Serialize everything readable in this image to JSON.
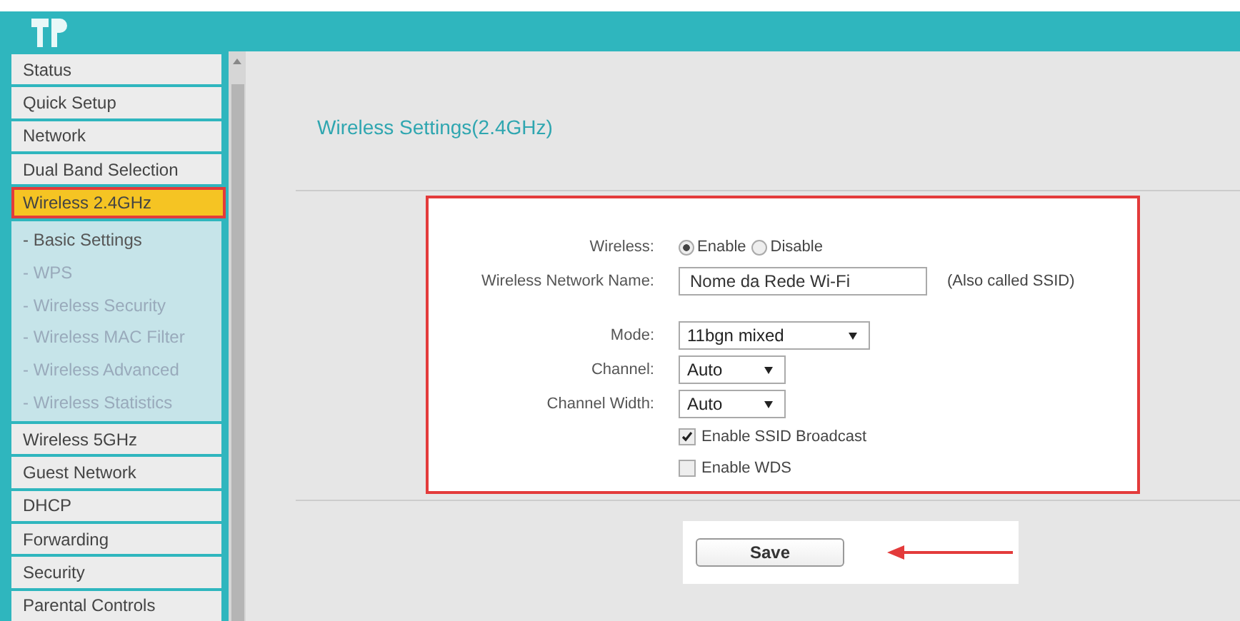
{
  "sidebar": {
    "items": [
      {
        "label": "Status",
        "selected": false
      },
      {
        "label": "Quick Setup",
        "selected": false
      },
      {
        "label": "Network",
        "selected": false
      },
      {
        "label": "Dual Band Selection",
        "selected": false
      },
      {
        "label": "Wireless 2.4GHz",
        "selected": true,
        "expanded": true,
        "children": [
          {
            "label": "- Basic Settings",
            "selected": true
          },
          {
            "label": "- WPS",
            "selected": false
          },
          {
            "label": "- Wireless Security",
            "selected": false
          },
          {
            "label": "- Wireless MAC Filter",
            "selected": false
          },
          {
            "label": "- Wireless Advanced",
            "selected": false
          },
          {
            "label": "- Wireless Statistics",
            "selected": false
          }
        ]
      },
      {
        "label": "Wireless 5GHz",
        "selected": false
      },
      {
        "label": "Guest Network",
        "selected": false
      },
      {
        "label": "DHCP",
        "selected": false
      },
      {
        "label": "Forwarding",
        "selected": false
      },
      {
        "label": "Security",
        "selected": false
      },
      {
        "label": "Parental Controls",
        "selected": false
      }
    ]
  },
  "page_title": "Wireless Settings(2.4GHz)",
  "form": {
    "wireless": {
      "label": "Wireless:",
      "options": [
        {
          "label": "Enable",
          "selected": true
        },
        {
          "label": "Disable",
          "selected": false
        }
      ]
    },
    "network_name": {
      "label": "Wireless Network Name:",
      "value": "Nome da Rede Wi-Fi",
      "hint": "(Also called SSID)"
    },
    "selects": [
      {
        "label": "Mode:",
        "value": "11bgn mixed"
      },
      {
        "label": "Channel:",
        "value": "Auto"
      },
      {
        "label": "Channel Width:",
        "value": "Auto"
      }
    ],
    "checkboxes": [
      {
        "label": "Enable SSID Broadcast",
        "checked": true
      },
      {
        "label": "Enable WDS",
        "checked": false
      }
    ]
  },
  "save_button": "Save"
}
